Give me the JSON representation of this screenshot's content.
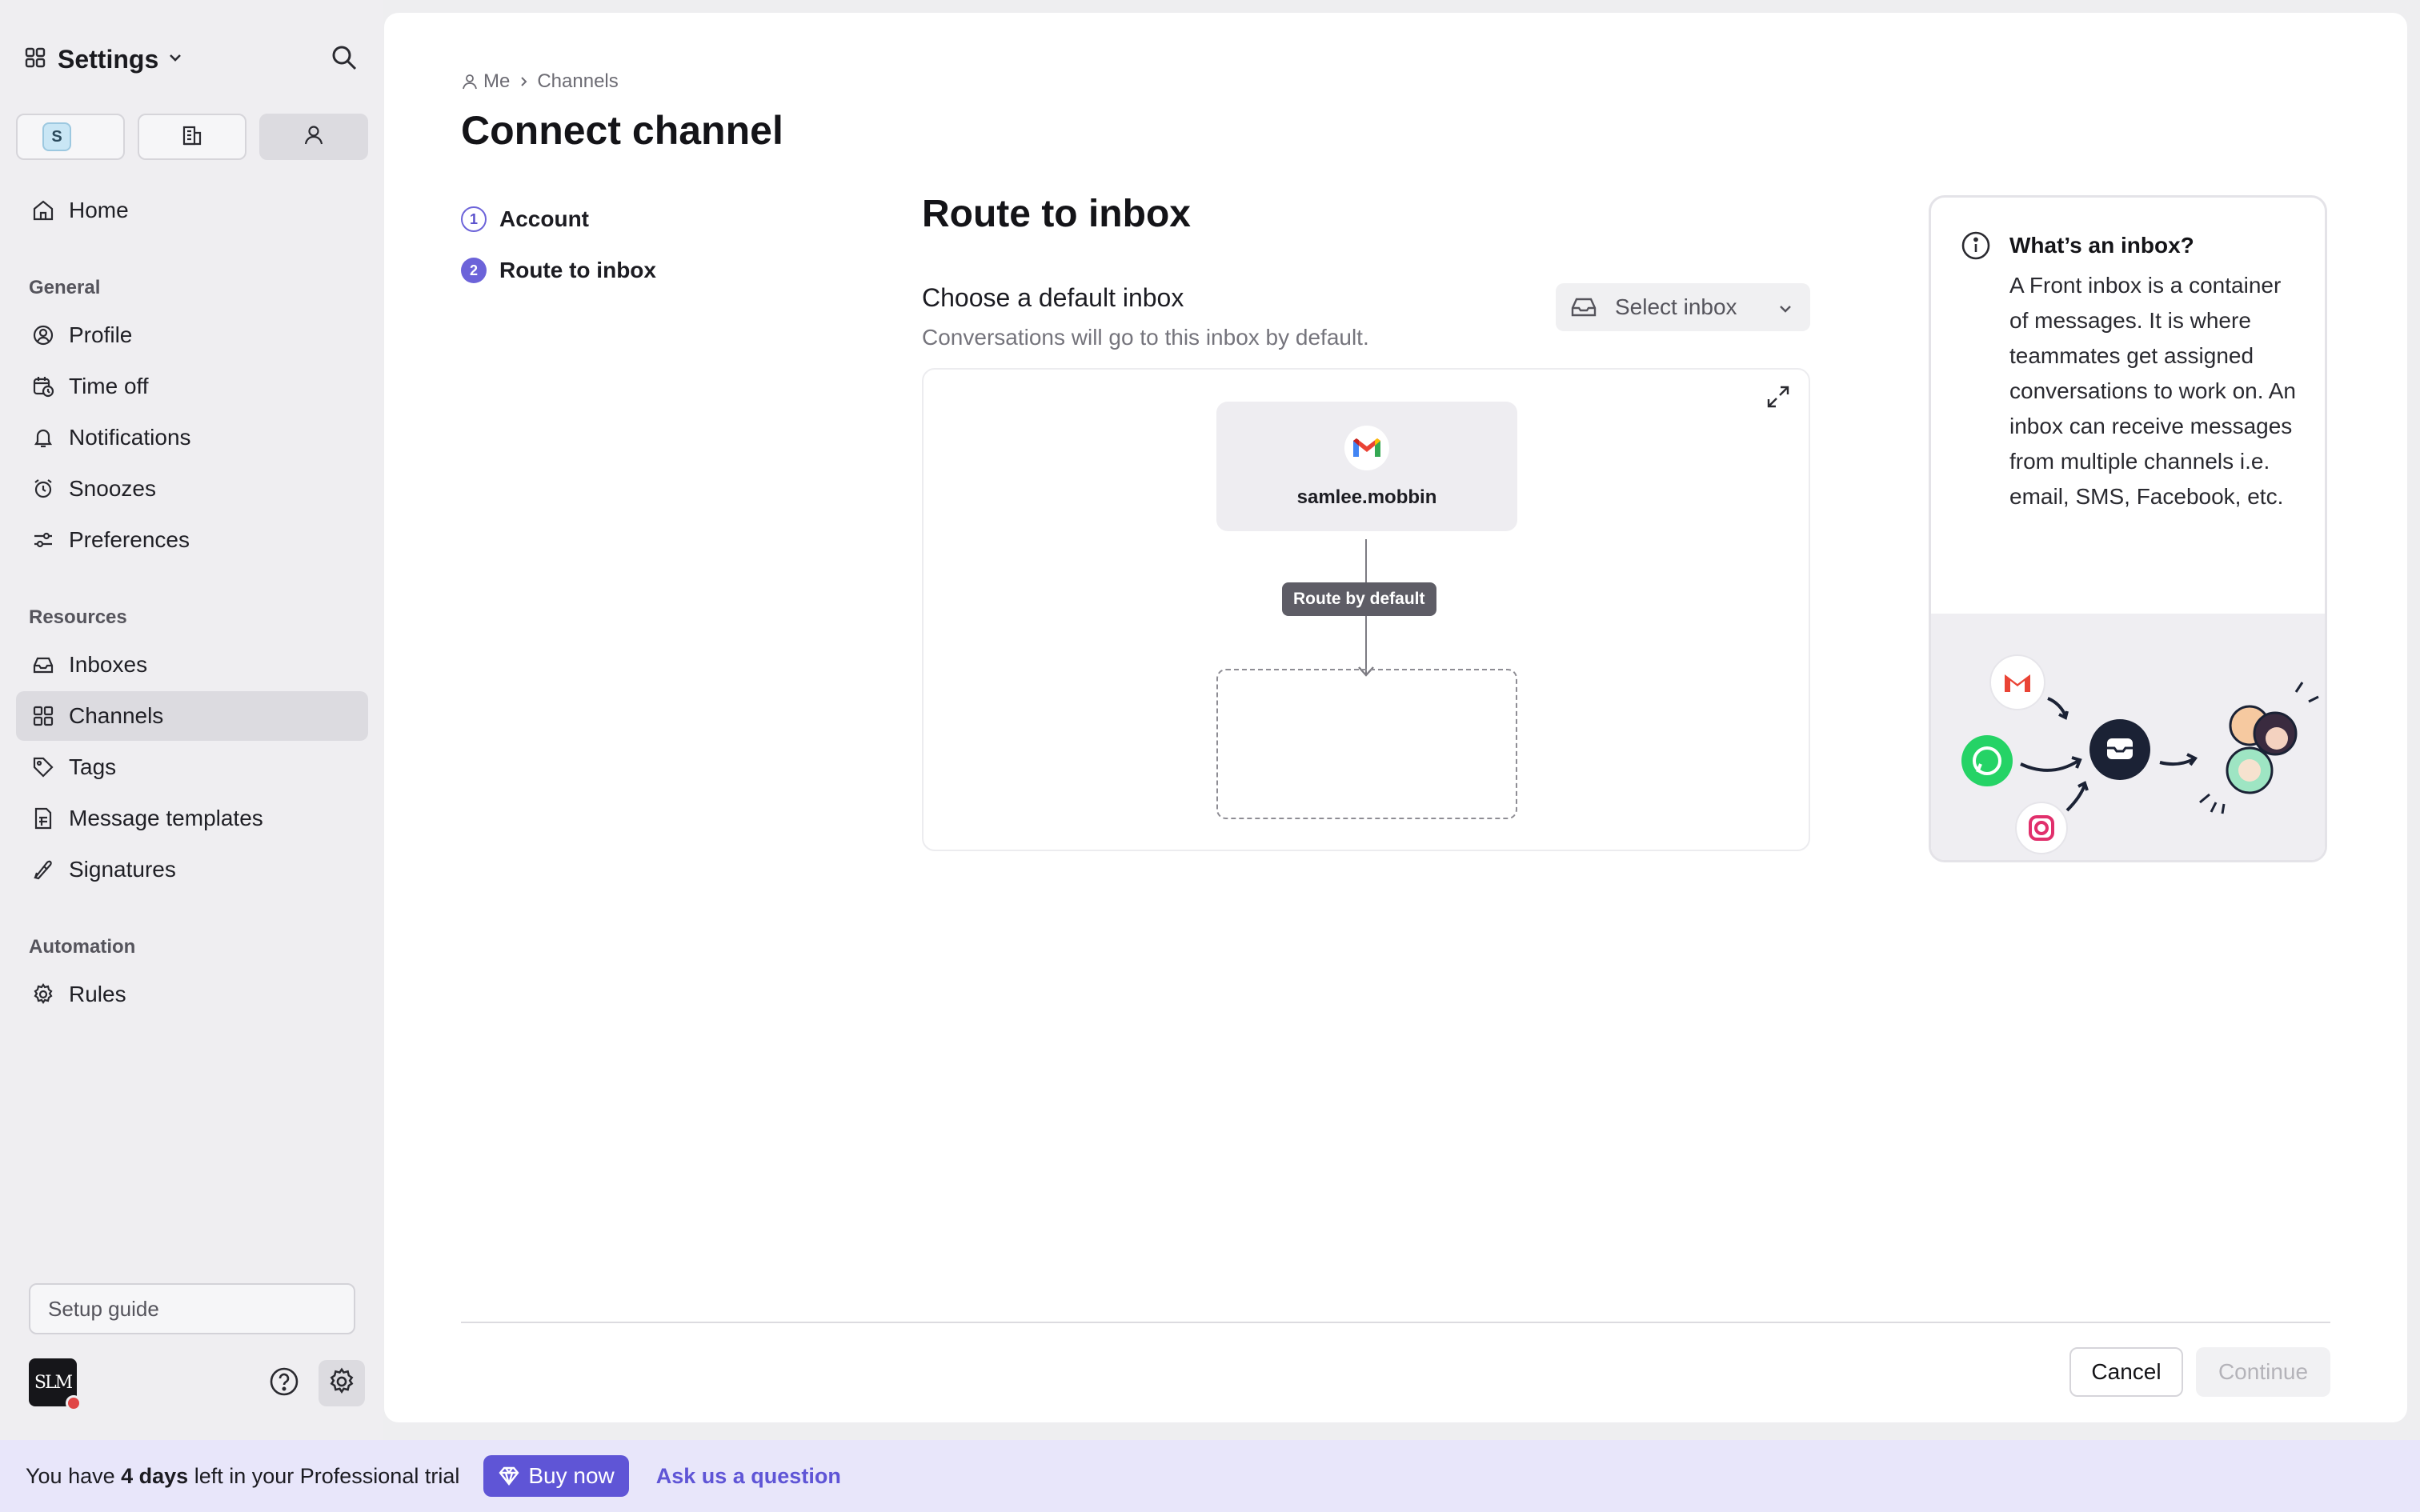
{
  "sidebar": {
    "title": "Settings",
    "workspace_badge": "S",
    "items_top": [
      {
        "label": "Home",
        "icon": "home-icon"
      }
    ],
    "sections": [
      {
        "title": "General",
        "items": [
          {
            "label": "Profile",
            "icon": "profile-icon"
          },
          {
            "label": "Time off",
            "icon": "calendar-clock-icon"
          },
          {
            "label": "Notifications",
            "icon": "bell-icon"
          },
          {
            "label": "Snoozes",
            "icon": "alarm-clock-icon"
          },
          {
            "label": "Preferences",
            "icon": "sliders-icon"
          }
        ]
      },
      {
        "title": "Resources",
        "items": [
          {
            "label": "Inboxes",
            "icon": "inbox-icon"
          },
          {
            "label": "Channels",
            "icon": "grid-icon",
            "active": true
          },
          {
            "label": "Tags",
            "icon": "tag-icon"
          },
          {
            "label": "Message templates",
            "icon": "template-icon"
          },
          {
            "label": "Signatures",
            "icon": "pen-icon"
          }
        ]
      },
      {
        "title": "Automation",
        "items": [
          {
            "label": "Rules",
            "icon": "gear-icon"
          }
        ]
      }
    ],
    "setup_guide": "Setup guide",
    "avatar_initials": "SLM"
  },
  "breadcrumb": {
    "parent": "Me",
    "current": "Channels"
  },
  "page_title": "Connect channel",
  "steps": [
    {
      "number": "1",
      "label": "Account"
    },
    {
      "number": "2",
      "label": "Route to inbox"
    }
  ],
  "route": {
    "title": "Route to inbox",
    "field_label": "Choose a default inbox",
    "field_help": "Conversations will go to this inbox by default.",
    "select_placeholder": "Select inbox",
    "source_name": "samlee.mobbin",
    "route_label": "Route by default"
  },
  "info": {
    "title": "What’s an inbox?",
    "body": "A Front inbox is a container of messages. It is where teammates get assigned conversations to work on. An inbox can receive messages from multiple channels i.e. email, SMS, Facebook, etc."
  },
  "footer": {
    "cancel": "Cancel",
    "continue": "Continue"
  },
  "banner": {
    "prefix": "You have ",
    "days": "4 days",
    "suffix": " left in your Professional trial",
    "buy": "Buy now",
    "ask": "Ask us a question"
  },
  "colors": {
    "accent": "#5f55d6",
    "gmail_red": "#ea4335",
    "whatsapp": "#25d366"
  }
}
